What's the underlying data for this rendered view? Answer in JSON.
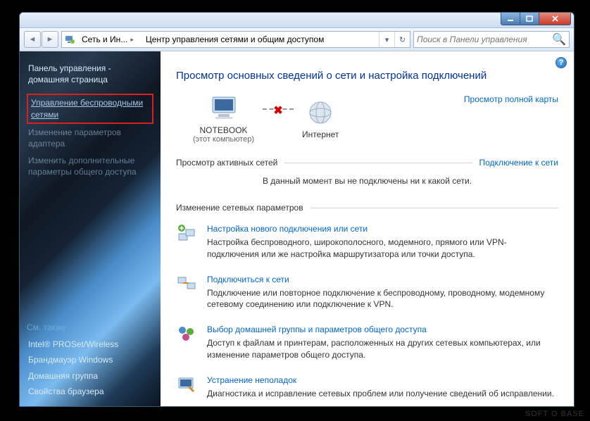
{
  "address": {
    "seg1": "Сеть и Ин...",
    "seg2": "Центр управления сетями и общим доступом"
  },
  "search": {
    "placeholder": "Поиск в Панели управления"
  },
  "sidebar": {
    "home": "Панель управления - домашняя страница",
    "items": [
      "Управление беспроводными сетями",
      "Изменение параметров адаптера",
      "Изменить дополнительные параметры общего доступа"
    ],
    "seealso_header": "См. также",
    "seealso": [
      "Intel® PROSet/Wireless",
      "Брандмауэр Windows",
      "Домашняя группа",
      "Свойства браузера"
    ]
  },
  "main": {
    "heading": "Просмотр основных сведений о сети и настройка подключений",
    "map_link": "Просмотр полной карты",
    "node1": {
      "name": "NOTEBOOK",
      "sub": "(этот компьютер)"
    },
    "node2": {
      "name": "Интернет"
    },
    "active_header": "Просмотр активных сетей",
    "active_connect": "Подключение к сети",
    "no_networks": "В данный момент вы не подключены ни к какой сети.",
    "change_header": "Изменение сетевых параметров",
    "tasks": [
      {
        "title": "Настройка нового подключения или сети",
        "desc": "Настройка беспроводного, широкополосного, модемного, прямого или VPN-подключения или же настройка маршрутизатора или точки доступа."
      },
      {
        "title": "Подключиться к сети",
        "desc": "Подключение или повторное подключение к беспроводному, проводному, модемному сетевому соединению или подключение к VPN."
      },
      {
        "title": "Выбор домашней группы и параметров общего доступа",
        "desc": "Доступ к файлам и принтерам, расположенных на других сетевых компьютерах, или изменение параметров общего доступа."
      },
      {
        "title": "Устранение неполадок",
        "desc": "Диагностика и исправление сетевых проблем или получение сведений об исправлении."
      }
    ]
  },
  "watermark": "SOFT O BASE"
}
